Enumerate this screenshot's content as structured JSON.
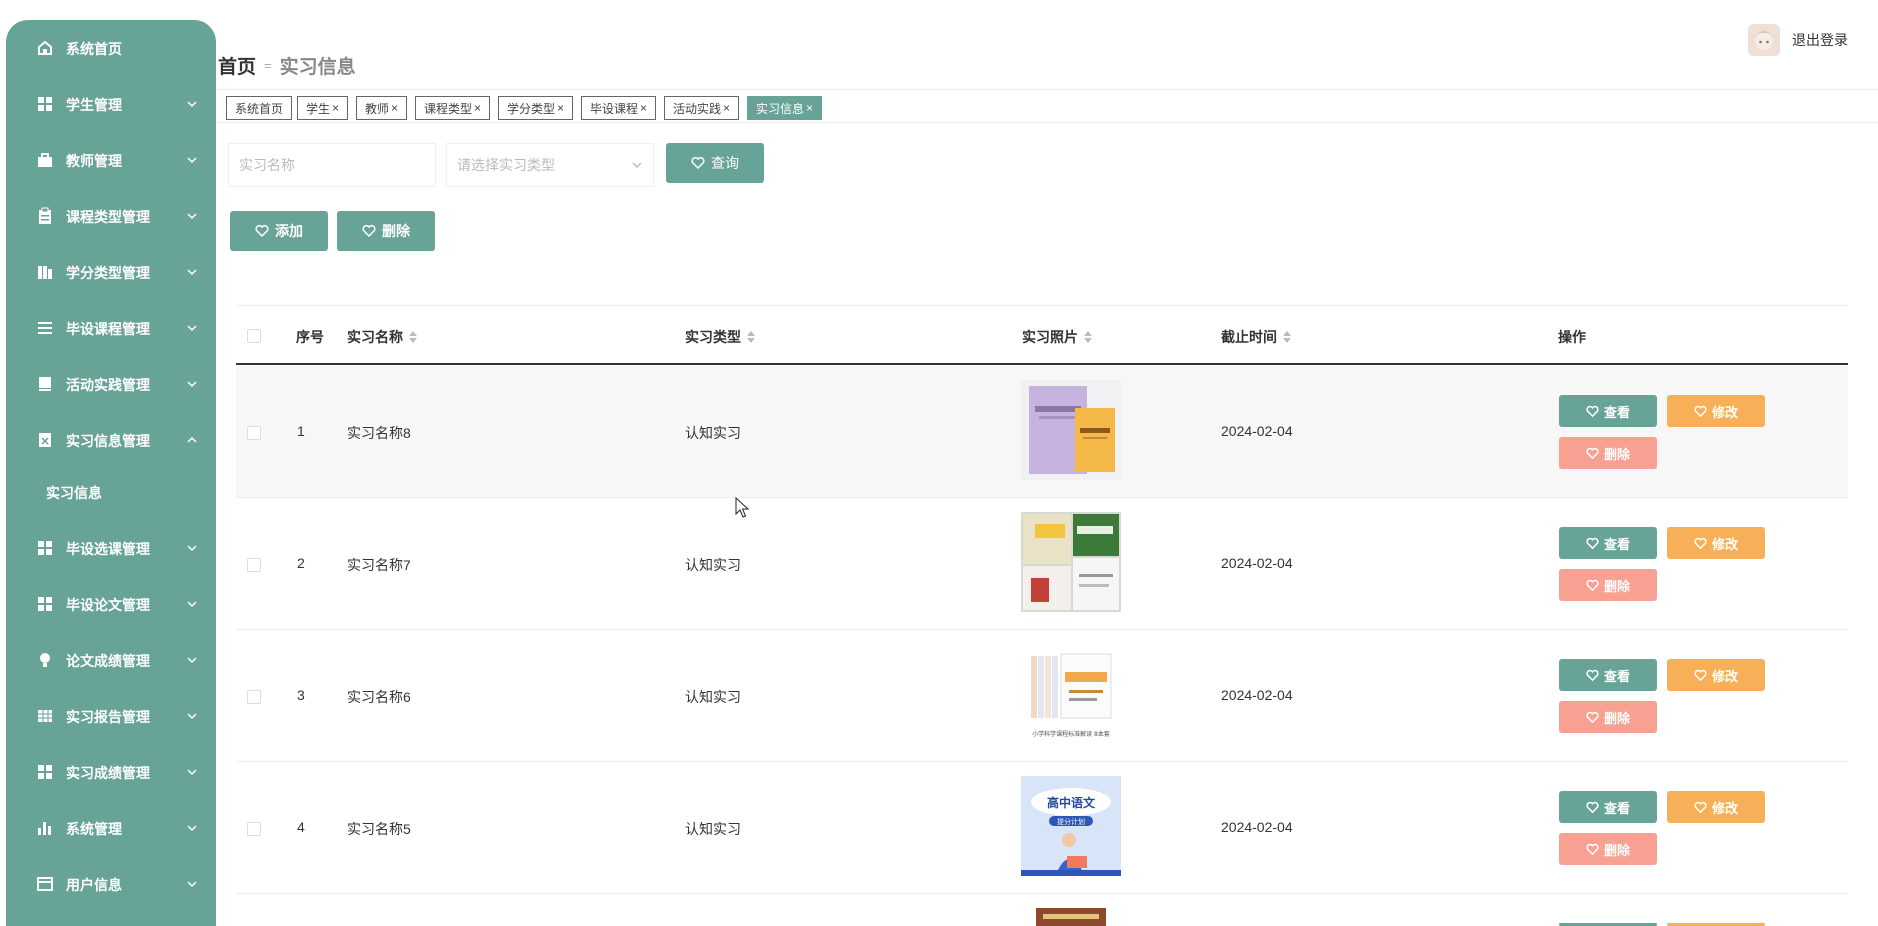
{
  "sidebar": {
    "items": [
      {
        "label": "系统首页",
        "icon": "home-icon"
      },
      {
        "label": "学生管理",
        "icon": "grid-icon"
      },
      {
        "label": "教师管理",
        "icon": "briefcase-icon"
      },
      {
        "label": "课程类型管理",
        "icon": "clipboard-icon"
      },
      {
        "label": "学分类型管理",
        "icon": "chart-bars-icon"
      },
      {
        "label": "毕设课程管理",
        "icon": "list-icon"
      },
      {
        "label": "活动实践管理",
        "icon": "book-icon"
      },
      {
        "label": "实习信息管理",
        "icon": "document-icon"
      },
      {
        "label": "毕设选课管理",
        "icon": "grid-icon"
      },
      {
        "label": "毕设论文管理",
        "icon": "grid-icon"
      },
      {
        "label": "论文成绩管理",
        "icon": "bulb-icon"
      },
      {
        "label": "实习报告管理",
        "icon": "table-icon"
      },
      {
        "label": "实习成绩管理",
        "icon": "grid-icon"
      },
      {
        "label": "系统管理",
        "icon": "bar-chart-icon"
      },
      {
        "label": "用户信息",
        "icon": "card-icon"
      }
    ],
    "submenu": {
      "label": "实习信息"
    }
  },
  "header": {
    "breadcrumb_home": "首页",
    "breadcrumb_sep": "=",
    "breadcrumb_current": "实习信息",
    "logout": "退出登录"
  },
  "tags": [
    {
      "label": "系统首页",
      "closable": false
    },
    {
      "label": "学生",
      "closable": true
    },
    {
      "label": "教师",
      "closable": true
    },
    {
      "label": "课程类型",
      "closable": true
    },
    {
      "label": "学分类型",
      "closable": true
    },
    {
      "label": "毕设课程",
      "closable": true
    },
    {
      "label": "活动实践",
      "closable": true
    },
    {
      "label": "实习信息",
      "closable": true,
      "active": true
    }
  ],
  "search": {
    "name_placeholder": "实习名称",
    "type_placeholder": "请选择实习类型",
    "query_label": "查询"
  },
  "actions": {
    "add_label": "添加",
    "delete_label": "删除"
  },
  "table": {
    "headers": [
      "序号",
      "实习名称",
      "实习类型",
      "实习照片",
      "截止时间",
      "操作"
    ],
    "rows": [
      {
        "index": "1",
        "name": "实习名称8",
        "type": "认知实习",
        "deadline": "2024-02-04"
      },
      {
        "index": "2",
        "name": "实习名称7",
        "type": "认知实习",
        "deadline": "2024-02-04"
      },
      {
        "index": "3",
        "name": "实习名称6",
        "type": "认知实习",
        "deadline": "2024-02-04"
      },
      {
        "index": "4",
        "name": "实习名称5",
        "type": "认知实习",
        "deadline": "2024-02-04"
      }
    ],
    "op_view": "查看",
    "op_edit": "修改",
    "op_delete": "删除",
    "photo_text": {
      "row3_caption": "小学科学课程标准解读 8本套",
      "row4_title": "高中语文",
      "row4_subtitle": "提分计划"
    }
  },
  "colors": {
    "primary": "#67a396",
    "edit": "#f8b058",
    "delete": "#f8a092"
  }
}
